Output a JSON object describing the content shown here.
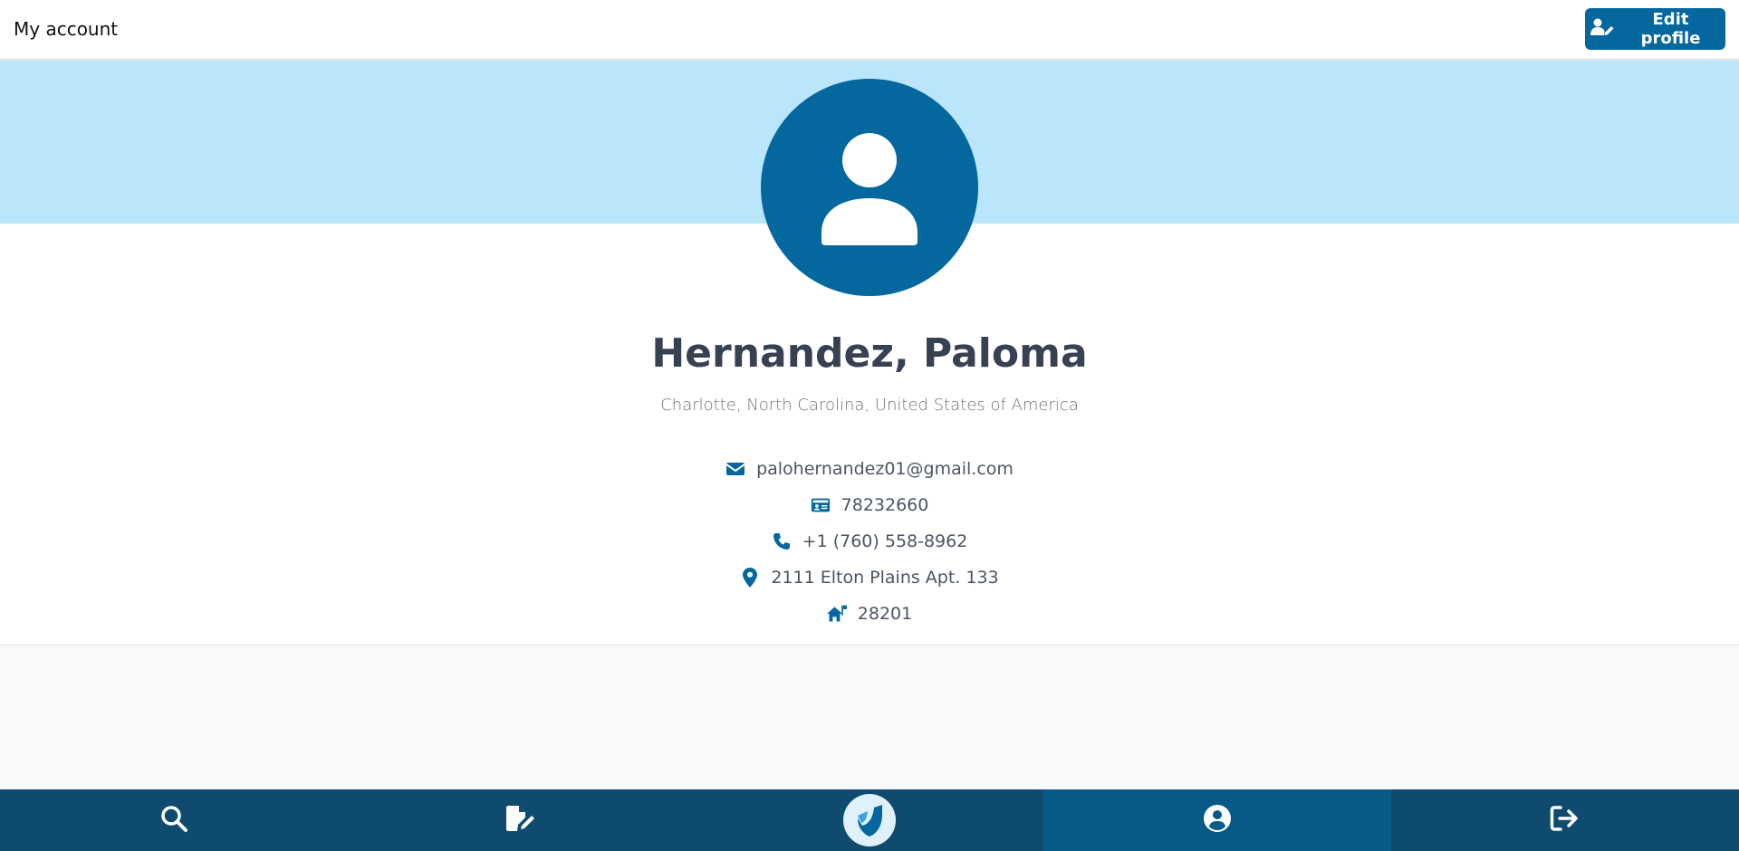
{
  "header": {
    "title": "My account",
    "edit_button_label": "Edit profile"
  },
  "profile": {
    "name": "Hernandez, Paloma",
    "location": "Charlotte, North Carolina, United States of America",
    "email": "palohernandez01@gmail.com",
    "id_number": "78232660",
    "phone": "+1 (760) 558-8962",
    "address": "2111 Elton Plains Apt. 133",
    "zip": "28201"
  },
  "icons": {
    "email": "envelope-icon",
    "id": "id-card-icon",
    "phone": "phone-icon",
    "address": "map-pin-icon",
    "zip": "house-flag-icon"
  },
  "bottom_nav": {
    "items": [
      {
        "icon": "search-icon",
        "active": false
      },
      {
        "icon": "document-edit-icon",
        "active": false
      },
      {
        "icon": "app-logo-icon",
        "active": false
      },
      {
        "icon": "user-circle-icon",
        "active": true
      },
      {
        "icon": "logout-icon",
        "active": false
      }
    ]
  },
  "colors": {
    "primary": "#04689e",
    "banner": "#bae6fb",
    "nav_bg": "#0f4b6e",
    "nav_active": "#075a88"
  }
}
